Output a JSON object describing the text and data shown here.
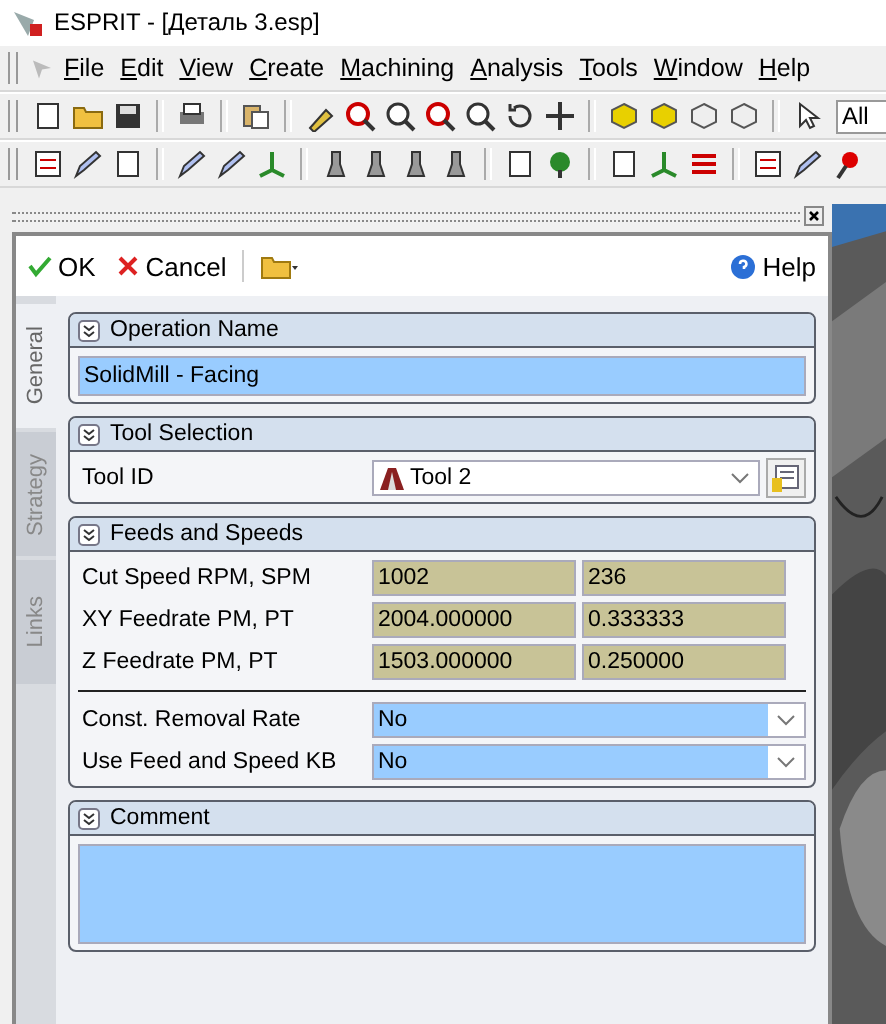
{
  "window": {
    "title": "ESPRIT - [Деталь 3.esp]"
  },
  "menu": [
    {
      "accel": "F",
      "rest": "ile"
    },
    {
      "accel": "E",
      "rest": "dit"
    },
    {
      "accel": "V",
      "rest": "iew"
    },
    {
      "accel": "C",
      "rest": "reate"
    },
    {
      "accel": "M",
      "rest": "achining"
    },
    {
      "accel": "A",
      "rest": "nalysis"
    },
    {
      "accel": "T",
      "rest": "ools"
    },
    {
      "accel": "W",
      "rest": "indow"
    },
    {
      "accel": "H",
      "rest": "elp"
    }
  ],
  "filter_field": {
    "value": "All"
  },
  "panel": {
    "ok": "OK",
    "cancel": "Cancel",
    "help": "Help",
    "tabs": [
      {
        "label": "General",
        "selected": true
      },
      {
        "label": "Strategy",
        "selected": false
      },
      {
        "label": "Links",
        "selected": false
      }
    ],
    "sections": [
      {
        "title": "Operation Name",
        "kind": "name",
        "value": "SolidMill - Facing"
      },
      {
        "title": "Tool Selection",
        "kind": "tool",
        "label": "Tool ID",
        "value": "Tool 2"
      },
      {
        "title": "Feeds and Speeds",
        "kind": "feeds",
        "rows": [
          {
            "label": "Cut Speed RPM, SPM",
            "values": [
              "1002",
              "236"
            ]
          },
          {
            "label": "XY Feedrate PM, PT",
            "values": [
              "2004.000000",
              "0.333333"
            ]
          },
          {
            "label": "Z Feedrate PM, PT",
            "values": [
              "1503.000000",
              "0.250000"
            ]
          }
        ],
        "options": [
          {
            "label": "Const. Removal Rate",
            "value": "No"
          },
          {
            "label": "Use Feed and Speed KB",
            "value": "No"
          }
        ]
      },
      {
        "title": "Comment",
        "kind": "comment"
      }
    ]
  }
}
